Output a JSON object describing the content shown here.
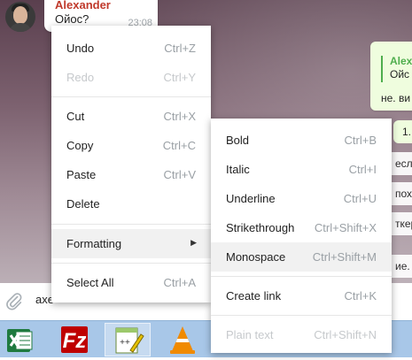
{
  "chat": {
    "incoming": {
      "sender": "Alexander",
      "text": "Ойос?",
      "time": "23:08"
    },
    "outgoing": {
      "reply_name": "Alex",
      "reply_text": "Ойс",
      "text": "не. ви",
      "small": "1."
    },
    "fragments": [
      "если",
      "пох",
      "ткер",
      "ие. я"
    ]
  },
  "composer": {
    "value": "axe"
  },
  "context_menu": {
    "items": [
      {
        "label": "Undo",
        "shortcut": "Ctrl+Z",
        "enabled": true
      },
      {
        "label": "Redo",
        "shortcut": "Ctrl+Y",
        "enabled": false
      },
      {
        "label": "Cut",
        "shortcut": "Ctrl+X",
        "enabled": true
      },
      {
        "label": "Copy",
        "shortcut": "Ctrl+C",
        "enabled": true
      },
      {
        "label": "Paste",
        "shortcut": "Ctrl+V",
        "enabled": true
      },
      {
        "label": "Delete",
        "shortcut": "",
        "enabled": true
      },
      {
        "label": "Formatting",
        "shortcut": "",
        "enabled": true
      },
      {
        "label": "Select All",
        "shortcut": "Ctrl+A",
        "enabled": true
      }
    ]
  },
  "formatting_menu": {
    "items": [
      {
        "label": "Bold",
        "shortcut": "Ctrl+B",
        "enabled": true
      },
      {
        "label": "Italic",
        "shortcut": "Ctrl+I",
        "enabled": true
      },
      {
        "label": "Underline",
        "shortcut": "Ctrl+U",
        "enabled": true
      },
      {
        "label": "Strikethrough",
        "shortcut": "Ctrl+Shift+X",
        "enabled": true
      },
      {
        "label": "Monospace",
        "shortcut": "Ctrl+Shift+M",
        "enabled": true
      },
      {
        "label": "Create link",
        "shortcut": "Ctrl+K",
        "enabled": true
      },
      {
        "label": "Plain text",
        "shortcut": "Ctrl+Shift+N",
        "enabled": false
      }
    ]
  },
  "taskbar": {
    "apps": [
      {
        "icon": "excel-icon"
      },
      {
        "icon": "filezilla-icon"
      },
      {
        "icon": "notepad-plus-plus-icon"
      },
      {
        "icon": "vlc-icon"
      }
    ]
  },
  "colors": {
    "sender": "#c0392b",
    "reply_accent": "#4fae4e",
    "outgoing_bubble": "#effdde",
    "taskbar": "#a8c7e8"
  }
}
